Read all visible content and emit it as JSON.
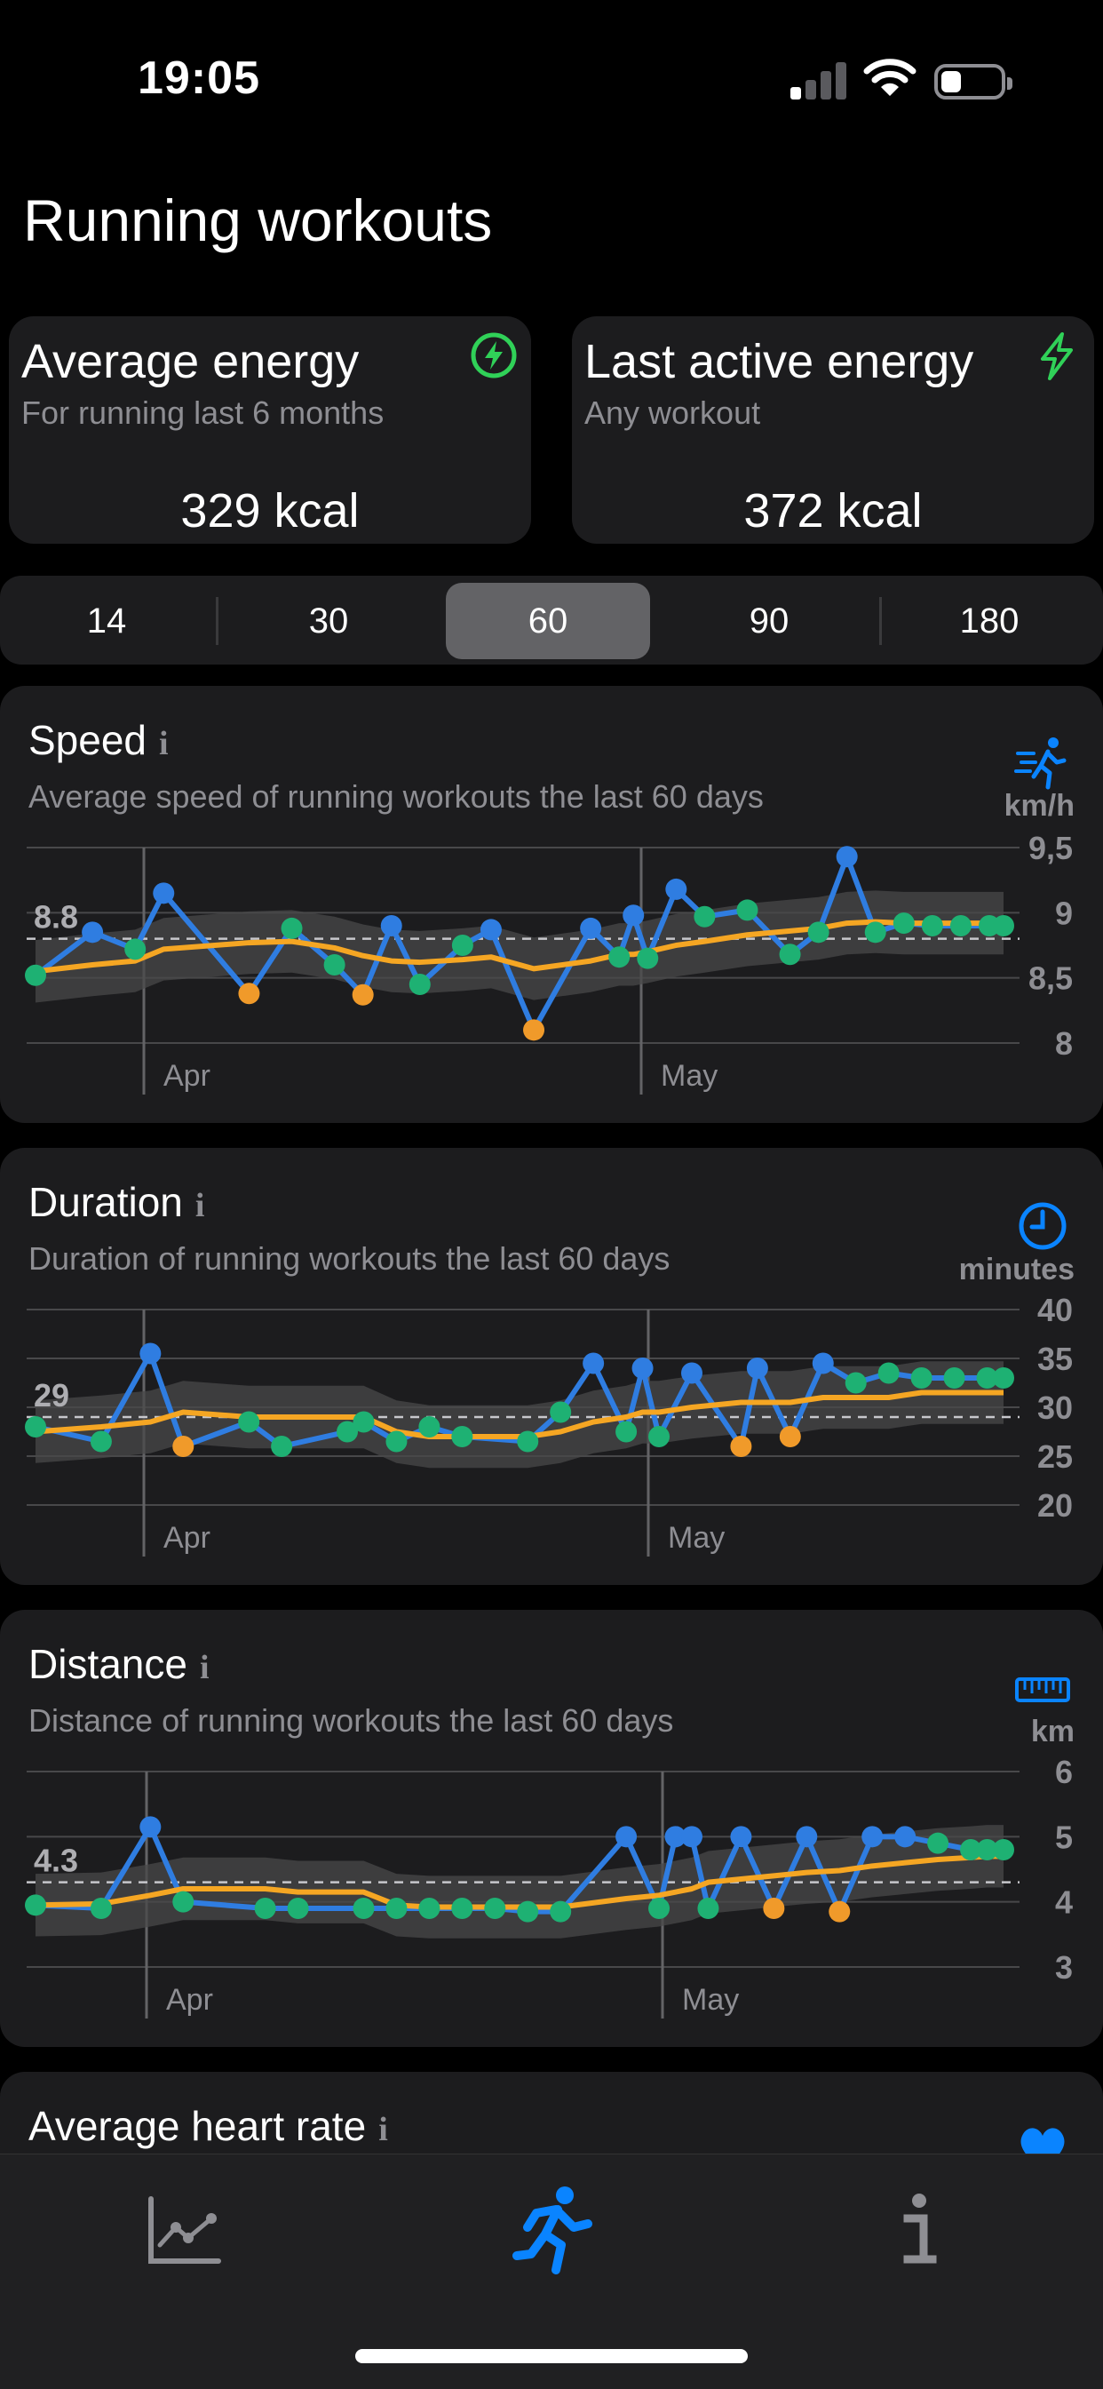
{
  "status_bar": {
    "time": "19:05"
  },
  "page_title": "Running workouts",
  "energy_cards": [
    {
      "title": "Average energy",
      "subtitle": "For running last 6 months",
      "value": "329 kcal",
      "icon": "bolt-circle-icon",
      "icon_color": "#30d158"
    },
    {
      "title": "Last active energy",
      "subtitle": "Any workout",
      "value": "372 kcal",
      "icon": "bolt-icon",
      "icon_color": "#30d158"
    }
  ],
  "range_selector": {
    "options": [
      "14",
      "30",
      "60",
      "90",
      "180"
    ],
    "selected": "60"
  },
  "colors": {
    "line": "#2f7de1",
    "avg": "#f5a623",
    "above": "#1eb173",
    "below": "#f09a2a",
    "band": "#48484a",
    "accent": "#0a84ff"
  },
  "charts": [
    {
      "title": "Speed",
      "subtitle": "Average speed of running workouts the last 60 days",
      "unit": "km/h",
      "icon": "person-running-speed-icon",
      "avg_label": "8.8",
      "month_labels": [
        "Apr",
        "May"
      ],
      "chart_data": {
        "type": "line",
        "ylim": [
          8,
          9.5
        ],
        "yticks": [
          "9,5",
          "9",
          "8,5",
          "8"
        ],
        "average": 8.8,
        "x": [
          0,
          4,
          7,
          9,
          15,
          18,
          21,
          23,
          25,
          27,
          30,
          32,
          35,
          39,
          41,
          42,
          43,
          45,
          47,
          50,
          53,
          55,
          57,
          59,
          61,
          63,
          65,
          67,
          68
        ],
        "values": [
          8.52,
          8.85,
          8.72,
          9.15,
          8.38,
          8.88,
          8.6,
          8.37,
          8.9,
          8.45,
          8.75,
          8.87,
          8.1,
          8.88,
          8.66,
          8.98,
          8.65,
          9.18,
          8.97,
          9.02,
          8.68,
          8.85,
          9.43,
          8.85,
          8.92,
          8.9,
          8.9,
          8.9,
          8.9
        ],
        "trend": [
          8.55,
          8.6,
          8.63,
          8.72,
          8.77,
          8.78,
          8.73,
          8.67,
          8.63,
          8.62,
          8.64,
          8.66,
          8.57,
          8.63,
          8.68,
          8.68,
          8.7,
          8.75,
          8.78,
          8.83,
          8.86,
          8.88,
          8.92,
          8.93,
          8.92,
          8.92,
          8.92,
          8.92,
          8.92
        ]
      }
    },
    {
      "title": "Duration",
      "subtitle": "Duration of running workouts the last 60 days",
      "unit": "minutes",
      "icon": "clock-icon",
      "avg_label": "29",
      "month_labels": [
        "Apr",
        "May"
      ],
      "chart_data": {
        "type": "line",
        "ylim": [
          20,
          40
        ],
        "yticks": [
          "40",
          "35",
          "30",
          "25",
          "20"
        ],
        "average": 29,
        "x": [
          0,
          4,
          7,
          9,
          13,
          15,
          19,
          20,
          22,
          24,
          26,
          30,
          32,
          34,
          36,
          37,
          38,
          40,
          43,
          44,
          46,
          48,
          50,
          52,
          54,
          56,
          58,
          59
        ],
        "values": [
          28,
          26.5,
          35.5,
          26,
          28.5,
          26,
          27.5,
          28.5,
          26.5,
          28,
          27,
          26.5,
          29.5,
          34.5,
          27.5,
          34,
          27,
          33.5,
          26,
          34,
          27,
          34.5,
          32.5,
          33.5,
          33,
          33,
          33,
          33
        ],
        "trend": [
          27.5,
          28,
          28.5,
          29.5,
          29,
          29,
          29,
          29,
          27.5,
          27,
          27,
          27,
          27.5,
          28.5,
          29,
          29.5,
          29.5,
          30,
          30.5,
          30.5,
          30.5,
          31,
          31,
          31,
          31.5,
          31.5,
          31.5,
          31.5
        ]
      }
    },
    {
      "title": "Distance",
      "subtitle": "Distance of running workouts the last 60 days",
      "unit": "km",
      "icon": "ruler-icon",
      "avg_label": "4.3",
      "month_labels": [
        "Apr",
        "May"
      ],
      "chart_data": {
        "type": "line",
        "ylim": [
          3,
          6
        ],
        "yticks": [
          "6",
          "5",
          "4",
          "3"
        ],
        "average": 4.3,
        "x": [
          0,
          4,
          7,
          9,
          14,
          16,
          20,
          22,
          24,
          26,
          28,
          30,
          32,
          36,
          38,
          39,
          40,
          41,
          43,
          45,
          47,
          49,
          51,
          53,
          55,
          57,
          58,
          59
        ],
        "values": [
          3.95,
          3.9,
          5.15,
          4.0,
          3.9,
          3.9,
          3.9,
          3.9,
          3.9,
          3.9,
          3.9,
          3.85,
          3.85,
          5.0,
          3.9,
          5.0,
          5.0,
          3.9,
          5.0,
          3.9,
          5.0,
          3.85,
          5.0,
          5.0,
          4.9,
          4.8,
          4.8,
          4.8
        ],
        "trend": [
          3.95,
          3.97,
          4.1,
          4.2,
          4.2,
          4.15,
          4.15,
          3.95,
          3.92,
          3.92,
          3.92,
          3.92,
          3.92,
          4.05,
          4.1,
          4.15,
          4.2,
          4.3,
          4.35,
          4.4,
          4.45,
          4.48,
          4.55,
          4.6,
          4.65,
          4.68,
          4.7,
          4.7
        ]
      }
    }
  ],
  "next_card": {
    "title": "Average heart rate",
    "icon": "heart-icon"
  },
  "tab_bar": {
    "tabs": [
      "chart-icon",
      "running-icon",
      "info-icon"
    ],
    "active": "running-icon"
  }
}
